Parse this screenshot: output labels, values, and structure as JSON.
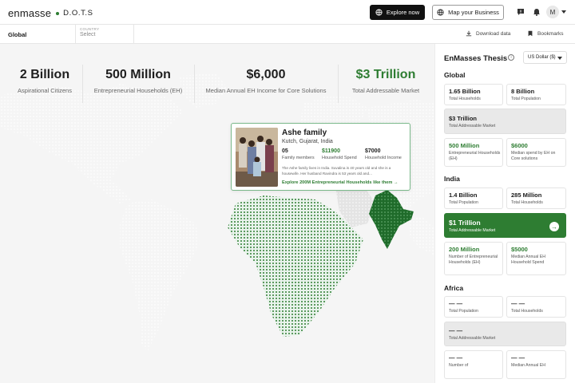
{
  "brand": {
    "name": "enmasse",
    "product": "D.O.T.S",
    "accent": "#2e7d32"
  },
  "topbar": {
    "explore_label": "Explore now",
    "map_business_label": "Map your Business",
    "avatar_initial": "M"
  },
  "filters": {
    "scope_label": "Global",
    "country_label": "COUNTRY",
    "country_placeholder": "Select",
    "download_label": "Download data",
    "bookmarks_label": "Bookmarks"
  },
  "stats": [
    {
      "value": "2 Billion",
      "label": "Aspirational Citizens",
      "color": "#1e1e1e"
    },
    {
      "value": "500 Million",
      "label": "Entrepreneurial Households (EH)",
      "color": "#1e1e1e"
    },
    {
      "value": "$6,000",
      "label": "Median Annual EH Income for Core Solutions",
      "color": "#1e1e1e"
    },
    {
      "value": "$3 Trillion",
      "label": "Total Addressable Market",
      "color": "#2e7d32"
    }
  ],
  "family_card": {
    "name": "Ashe family",
    "location": "Kutch, Gujarat, India",
    "members_value": "05",
    "members_label": "Family members",
    "spend_value": "$11900",
    "spend_label": "Household Spend",
    "income_value": "$7000",
    "income_label": "Household Income",
    "description": "The Ashe family lives in India. Suvalina is 40 years old and she is a housewife. Her husband Ravindra is 53 years old and...",
    "link_label": "Explore 200M Entrepreneurial Households like them →"
  },
  "panel": {
    "title": "EnMasses Thesis",
    "currency": "US Dollar ($)",
    "global": {
      "heading": "Global",
      "households_value": "1.65 Billion",
      "households_label": "Total Households",
      "population_value": "8 Billion",
      "population_label": "Total Population",
      "tam_value": "$3 Trillion",
      "tam_label": "Total Addressable Market",
      "eh_value": "500 Million",
      "eh_label": "Entrepreneurial Households (EH)",
      "median_value": "$6000",
      "median_label": "Median spend by EH on Core solutions"
    },
    "india": {
      "heading": "India",
      "population_value": "1.4 Billion",
      "population_label": "Total Population",
      "households_value": "285 Million",
      "households_label": "Total Households",
      "tam_value": "$1 Trillion",
      "tam_label": "Total Addressable Market",
      "eh_value": "200 Million",
      "eh_label": "Number of Entrepreneurial Households (EH)",
      "median_value": "$5000",
      "median_label": "Median Annual EH Household Spend"
    },
    "africa": {
      "heading": "Africa",
      "population_value": "— —",
      "population_label": "Total Population",
      "households_value": "— —",
      "households_label": "Total Households",
      "tam_value": "— —",
      "tam_label": "Total Addressable Market",
      "eh_value": "— —",
      "eh_label": "Number of",
      "median_value": "— —",
      "median_label": "Median Annual EH"
    }
  }
}
